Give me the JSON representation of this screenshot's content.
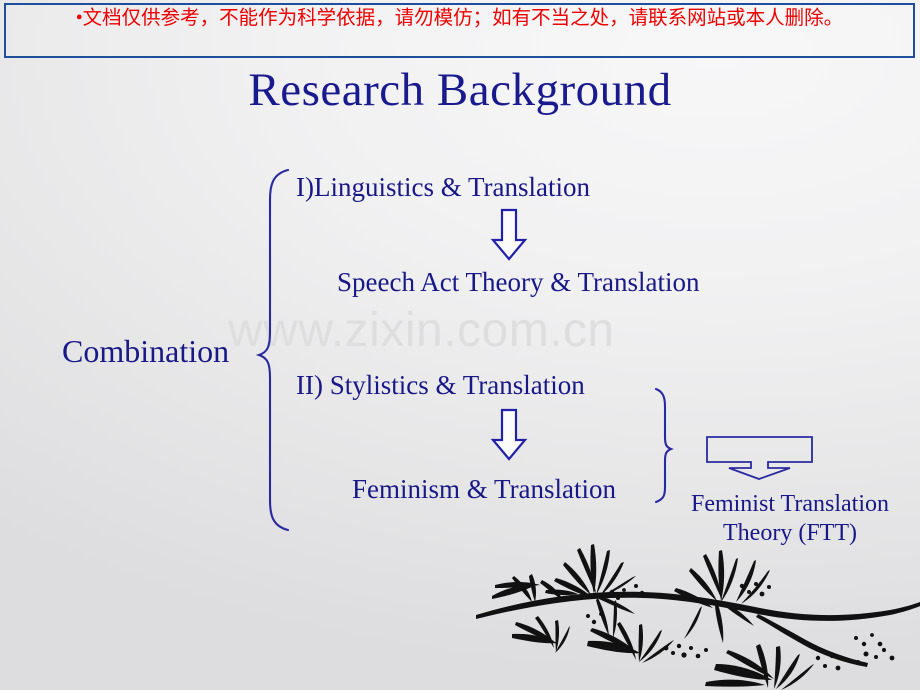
{
  "banner": {
    "bullet": "•",
    "text": "文档仅供参考，不能作为科学依据，请勿模仿；如有不当之处，请联系网站或本人删除。",
    "border_color": "#1f4e9c",
    "text_color": "#ee0000"
  },
  "title": {
    "text": "Research Background",
    "color": "#1a1a8f"
  },
  "watermark": {
    "text": "www.zixin.com.cn",
    "color": "#dedede"
  },
  "diagram": {
    "accent_color": "#181887",
    "root_label": "Combination",
    "branch_one": {
      "source": "I)Linguistics & Translation",
      "arrow": "down-arrow-icon",
      "result": "Speech Act Theory & Translation"
    },
    "branch_two": {
      "source": "II) Stylistics & Translation",
      "arrow": "down-arrow-icon",
      "result": "Feminism & Translation"
    },
    "outcome": {
      "callout": "down-arrow-callout-icon",
      "label": "Feminist Translation Theory (FTT)"
    },
    "braces": [
      {
        "name": "left-brace",
        "direction": "right"
      },
      {
        "name": "right-brace",
        "direction": "right"
      }
    ]
  },
  "decoration": {
    "name": "bamboo-branch-illustration",
    "color": "#111111"
  }
}
